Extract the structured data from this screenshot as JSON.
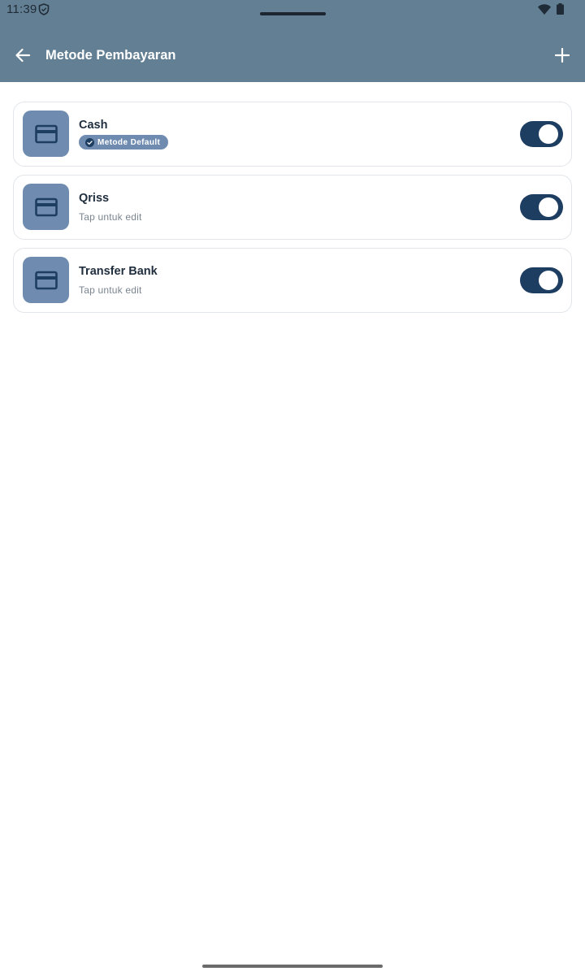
{
  "status_bar": {
    "time": "11:39"
  },
  "app_bar": {
    "title": "Metode Pembayaran",
    "back_icon": "arrow-left-icon",
    "add_icon": "plus-icon"
  },
  "colors": {
    "header": "#637f93",
    "icon_tile": "#6f8cb0",
    "toggle_on": "#1d3d61",
    "title_text": "#1f2d3d"
  },
  "payment_methods": [
    {
      "name": "Cash",
      "badge": "Metode Default",
      "enabled": true,
      "icon": "credit-card-icon"
    },
    {
      "name": "Qriss",
      "subtitle": "Tap untuk edit",
      "enabled": true,
      "icon": "credit-card-icon"
    },
    {
      "name": "Transfer Bank",
      "subtitle": "Tap untuk edit",
      "enabled": true,
      "icon": "credit-card-icon"
    }
  ]
}
